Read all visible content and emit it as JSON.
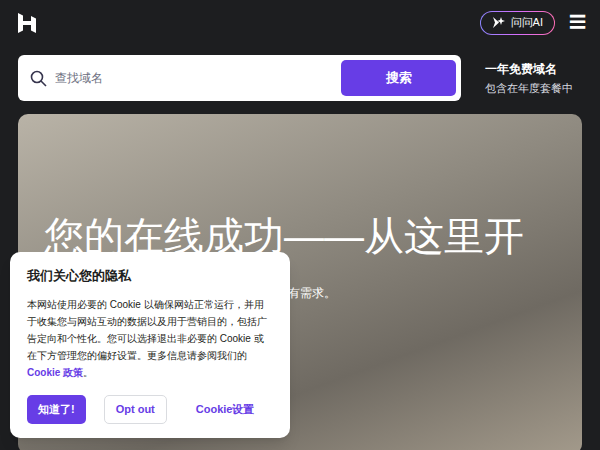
{
  "header": {
    "ai_button": "问问AI",
    "menu_icon": "☰"
  },
  "search": {
    "placeholder": "查找域名",
    "button": "搜索"
  },
  "promo": {
    "title": "一年免费域名",
    "subtitle": "包含在年度套餐中"
  },
  "hero": {
    "headline": "您的在线成功——从这里开",
    "subtitle": "有需求。"
  },
  "cookie": {
    "title": "我们关心您的隐私",
    "body": "本网站使用必要的 Cookie 以确保网站正常运行，并用于收集您与网站互动的数据以及用于营销目的，包括广告定向和个性化。您可以选择退出非必要的 Cookie 或在下方管理您的偏好设置。更多信息请参阅我们的",
    "link": "Cookie 政策",
    "link_suffix": "。",
    "buttons": [
      {
        "label": "知道了!",
        "kind": "primary"
      },
      {
        "label": "Opt out",
        "kind": "outline"
      },
      {
        "label": "Cookie设置",
        "kind": "link"
      }
    ]
  }
}
